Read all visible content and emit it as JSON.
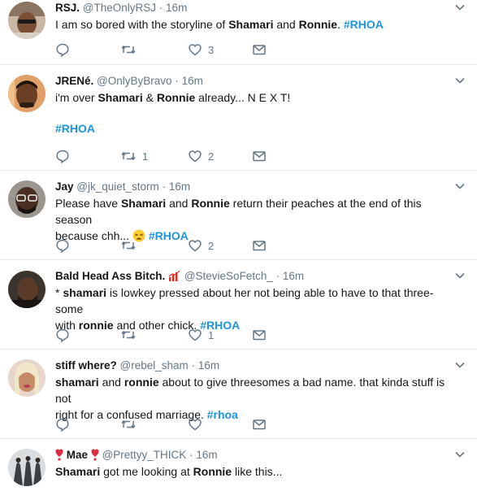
{
  "tweets": [
    {
      "name": "RSJ.",
      "handle": "@TheOnlyRSJ",
      "dot": "·",
      "time": "16m",
      "segments": [
        "I am so bored with the storyline of ",
        "Shamari",
        " and ",
        "Ronnie",
        ".  ",
        "#RHOA"
      ],
      "reply_count": "",
      "retweet_count": "",
      "like_count": "3"
    },
    {
      "name": "JRENé.",
      "handle": "@OnlyByBravo",
      "dot": "·",
      "time": "16m",
      "segments": [
        "i'm over ",
        "Shamari",
        " & ",
        "Ronnie",
        " already... N E X T!"
      ],
      "hashtag_line": "#RHOA",
      "reply_count": "",
      "retweet_count": "1",
      "like_count": "2"
    },
    {
      "name": "Jay",
      "handle": "@jk_quiet_storm",
      "dot": "·",
      "time": "16m",
      "segments": [
        "Please have ",
        "Shamari",
        " and ",
        "Ronnie",
        " return their peaches at the end of this season"
      ],
      "line2_text": "because chh... ",
      "hashtag": "#RHOA",
      "reply_count": "",
      "retweet_count": "",
      "like_count": "2"
    },
    {
      "name": "Bald Head Ass Bitch.",
      "handle": "@StevieSoFetch_",
      "dot": "·",
      "time": "16m",
      "line1_prefix": "* ",
      "line1_bold": "shamari",
      "line1_rest": " is lowkey pressed about her not being able to have to that three-some",
      "line2_prefix": "with ",
      "line2_bold": "ronnie",
      "line2_rest": " and other chick. ",
      "hashtag": "#RHOA",
      "reply_count": "",
      "retweet_count": "",
      "like_count": "1"
    },
    {
      "name": "stiff where?",
      "handle": "@rebel_sham",
      "dot": "·",
      "time": "16m",
      "line1_bold_a": "shamari",
      "line1_mid": " and ",
      "line1_bold_b": "ronnie",
      "line1_rest": " about to give threesomes a bad name. that kinda stuff is not",
      "line2_text": "right for a confused marriage. ",
      "hashtag": "#rhoa",
      "reply_count": "",
      "retweet_count": "",
      "like_count": ""
    },
    {
      "name": "Mae",
      "handle": "@Prettyy_THICK",
      "dot": "·",
      "time": "16m",
      "line1_bold_a": "Shamari",
      "line1_mid": " got me looking at ",
      "line1_bold_b": "Ronnie",
      "line1_rest": " like this..."
    }
  ],
  "icons": {
    "reply": "reply-icon",
    "retweet": "retweet-icon",
    "like": "heart-icon",
    "message": "envelope-icon",
    "menu": "chevron-down-icon"
  },
  "colors": {
    "hashtag": "#1b95e0",
    "meta": "#657786",
    "text": "#14171a",
    "divider": "#e6ecf0"
  }
}
